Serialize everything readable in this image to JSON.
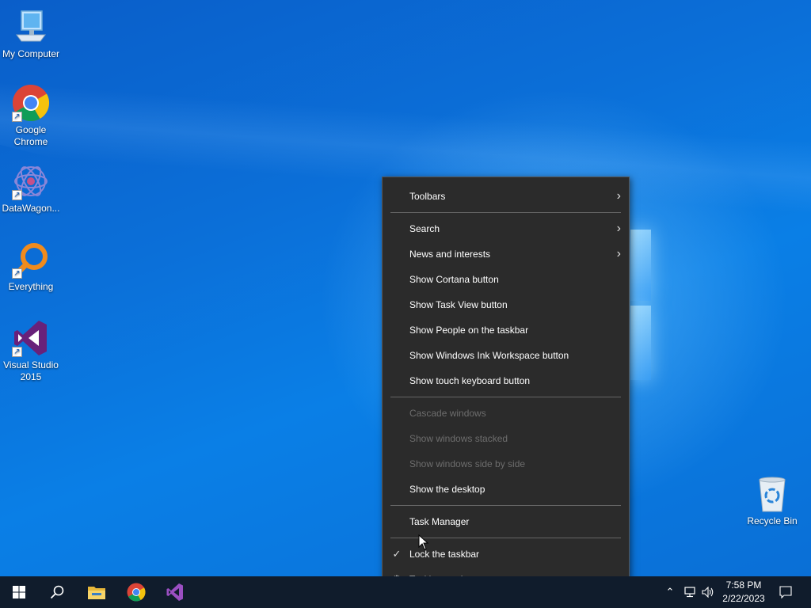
{
  "desktop": {
    "icons": [
      {
        "label": "My Computer",
        "icon": "computer-icon"
      },
      {
        "label": "Google Chrome",
        "icon": "chrome-icon"
      },
      {
        "label": "DataWagon...",
        "icon": "datawagon-icon"
      },
      {
        "label": "Everything",
        "icon": "everything-icon"
      },
      {
        "label": "Visual Studio 2015",
        "icon": "visual-studio-icon"
      },
      {
        "label": "Recycle Bin",
        "icon": "recycle-bin-icon"
      }
    ]
  },
  "context_menu": {
    "items": [
      {
        "label": "Toolbars",
        "submenu": true,
        "enabled": true
      },
      {
        "label": "Search",
        "submenu": true,
        "enabled": true
      },
      {
        "label": "News and interests",
        "submenu": true,
        "enabled": true
      },
      {
        "label": "Show Cortana button",
        "enabled": true
      },
      {
        "label": "Show Task View button",
        "enabled": true
      },
      {
        "label": "Show People on the taskbar",
        "enabled": true
      },
      {
        "label": "Show Windows Ink Workspace button",
        "enabled": true
      },
      {
        "label": "Show touch keyboard button",
        "enabled": true
      },
      {
        "label": "Cascade windows",
        "enabled": false
      },
      {
        "label": "Show windows stacked",
        "enabled": false
      },
      {
        "label": "Show windows side by side",
        "enabled": false
      },
      {
        "label": "Show the desktop",
        "enabled": true
      },
      {
        "label": "Task Manager",
        "enabled": true
      },
      {
        "label": "Lock the taskbar",
        "enabled": true,
        "checked": true
      },
      {
        "label": "Taskbar settings",
        "enabled": true,
        "icon": "gear-icon"
      }
    ]
  },
  "taskbar": {
    "buttons": [
      "start-icon",
      "search-icon",
      "file-explorer-icon",
      "chrome-icon",
      "visual-studio-icon"
    ],
    "tray": [
      "chevron-up-icon",
      "network-icon",
      "volume-icon"
    ],
    "clock": {
      "time": "7:58 PM",
      "date": "2/22/2023"
    },
    "notification_icon": "action-center-icon"
  },
  "colors": {
    "menu_bg": "#2b2b2b",
    "taskbar_bg": "#101c2c",
    "desktop_blue": "#0a6fd6",
    "disabled_text": "#6d6d6d"
  }
}
